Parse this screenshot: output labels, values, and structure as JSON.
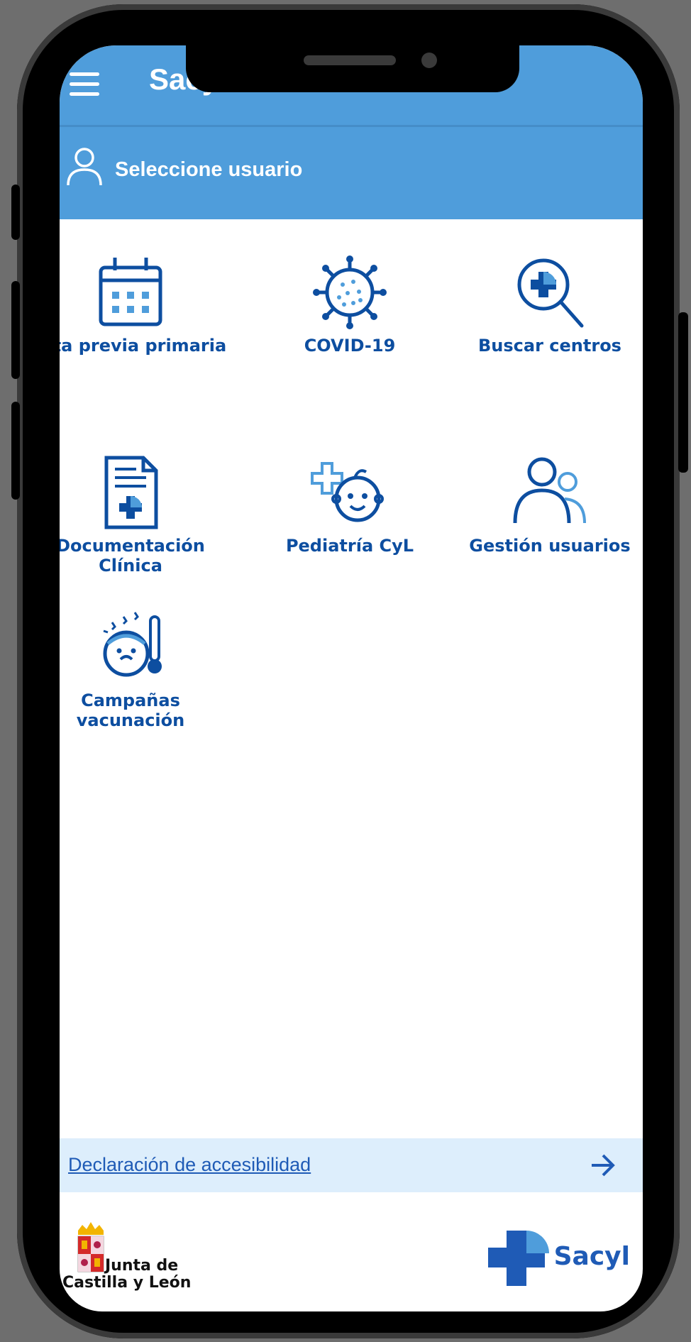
{
  "app": {
    "title": "Sacyl Conecta"
  },
  "user_bar": {
    "label": "Seleccione usuario"
  },
  "tiles": [
    {
      "label": "Cita previa primaria",
      "icon": "calendar-icon"
    },
    {
      "label": "COVID-19",
      "icon": "virus-icon"
    },
    {
      "label": "Buscar centros",
      "icon": "search-plus-icon"
    },
    {
      "label_lines": [
        "Documentación",
        "Clínica"
      ],
      "icon": "document-plus-icon"
    },
    {
      "label": "Pediatría CyL",
      "icon": "baby-face-icon"
    },
    {
      "label": "Gestión usuarios",
      "icon": "users-icon"
    },
    {
      "label_lines": [
        "Campañas",
        "vacunación"
      ],
      "icon": "fever-face-icon"
    }
  ],
  "accessibility": {
    "label": "Declaración de accesibilidad"
  },
  "footer": {
    "left_logo_lines": [
      "Junta de",
      "Castilla y León"
    ],
    "right_logo": "Sacyl"
  },
  "colors": {
    "header": "#4f9ddb",
    "accent": "#0d4ea0",
    "access_bg": "#ddeefc"
  }
}
